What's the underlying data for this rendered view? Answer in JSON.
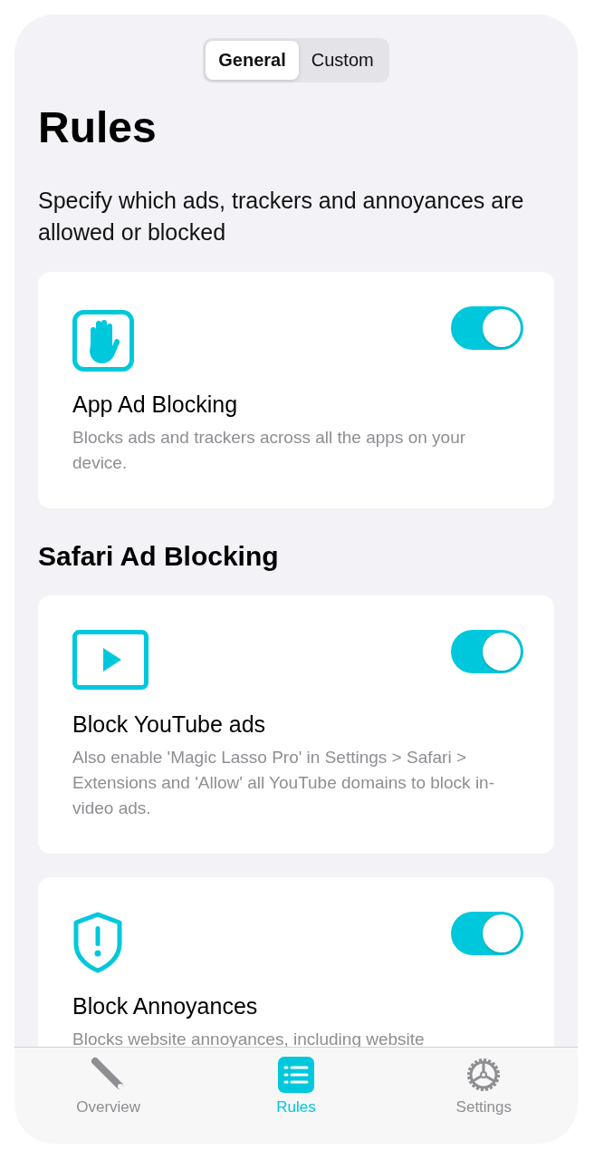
{
  "segmented": [
    {
      "label": "General",
      "selected": true
    },
    {
      "label": "Custom",
      "selected": false
    }
  ],
  "title": "Rules",
  "subtitle": "Specify which ads, trackers and annoyances are allowed or blocked",
  "sections": [
    {
      "cards": [
        {
          "kind": "hand",
          "on": true,
          "title": "App Ad Blocking",
          "description": "Blocks ads and trackers across all the apps on your device."
        }
      ]
    },
    {
      "heading": "Safari Ad Blocking",
      "cards": [
        {
          "kind": "play",
          "on": true,
          "title": "Block YouTube ads",
          "description": "Also enable 'Magic Lasso Pro' in Settings > Safari > Extensions and 'Allow' all YouTube domains to block in-video ads."
        },
        {
          "kind": "shield",
          "on": true,
          "title": "Block Annoyances",
          "description": "Blocks website annoyances, including website"
        }
      ]
    }
  ],
  "tab_bar": [
    {
      "kind": "wand",
      "label": "Overview",
      "selected": false
    },
    {
      "kind": "list",
      "label": "Rules",
      "selected": true
    },
    {
      "kind": "gear",
      "label": "Settings",
      "selected": false
    }
  ]
}
